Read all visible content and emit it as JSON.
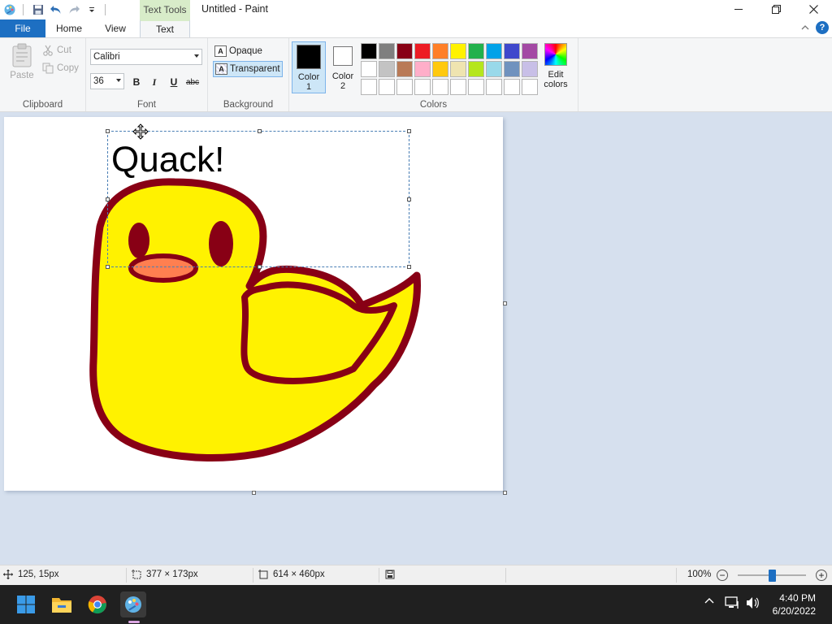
{
  "window": {
    "title": "Untitled - Paint",
    "context_tab_label": "Text Tools"
  },
  "tabs": {
    "file": "File",
    "home": "Home",
    "view": "View",
    "text": "Text"
  },
  "clipboard": {
    "paste": "Paste",
    "cut": "Cut",
    "copy": "Copy",
    "label": "Clipboard"
  },
  "font": {
    "family": "Calibri",
    "size": "36",
    "bold": "B",
    "italic": "I",
    "underline": "U",
    "strikethrough": "abc",
    "label": "Font"
  },
  "background": {
    "opaque": "Opaque",
    "transparent": "Transparent",
    "label": "Background",
    "selected": "transparent"
  },
  "colors": {
    "color1_label_a": "Color",
    "color1_label_b": "1",
    "color2_label_a": "Color",
    "color2_label_b": "2",
    "color1_value": "#000000",
    "color2_value": "#ffffff",
    "edit_a": "Edit",
    "edit_b": "colors",
    "label": "Colors",
    "palette": [
      "#000000",
      "#7f7f7f",
      "#880015",
      "#ed1c24",
      "#ff7f27",
      "#fff200",
      "#22b14c",
      "#00a2e8",
      "#3f48cc",
      "#a349a4",
      "#ffffff",
      "#c3c3c3",
      "#b97a57",
      "#ffaec9",
      "#ffc90e",
      "#efe4b0",
      "#b5e61d",
      "#99d9ea",
      "#7092be",
      "#c8bfe7",
      "#ffffff",
      "#ffffff",
      "#ffffff",
      "#ffffff",
      "#ffffff",
      "#ffffff",
      "#ffffff",
      "#ffffff",
      "#ffffff",
      "#ffffff"
    ]
  },
  "canvas": {
    "text": "Quack!",
    "duck_fill": "#fff200",
    "duck_outline": "#880015",
    "beak_fill": "#ff7f50"
  },
  "status": {
    "cursor_pos": "125, 15px",
    "selection_size": "377 × 173px",
    "canvas_size": "614 × 460px",
    "zoom": "100%"
  },
  "taskbar": {
    "time": "4:40 PM",
    "date": "6/20/2022"
  }
}
